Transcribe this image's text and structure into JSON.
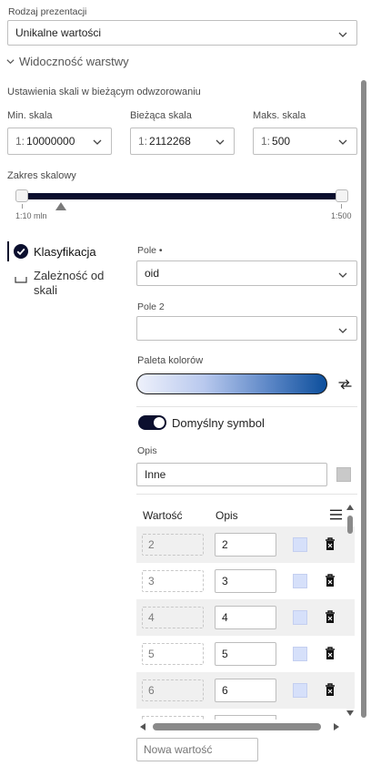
{
  "presentation": {
    "label": "Rodzaj prezentacji",
    "value": "Unikalne wartości"
  },
  "visibility": {
    "section_title": "Widoczność warstwy",
    "scale_settings_label": "Ustawienia skali w bieżącym odwzorowaniu",
    "min_scale": {
      "label": "Min. skala",
      "prefix": "1:",
      "value": "10000000"
    },
    "current_scale": {
      "label": "Bieżąca skala",
      "prefix": "1:",
      "value": "2112268"
    },
    "max_scale": {
      "label": "Maks. skala",
      "prefix": "1:",
      "value": "500"
    },
    "range": {
      "label": "Zakres skalowy",
      "min_label": "1:10 mln",
      "max_label": "1:500"
    }
  },
  "tabs": {
    "classification": "Klasyfikacja",
    "scale_dependency": "Zależność od skali"
  },
  "form": {
    "field_label": "Pole •",
    "field_value": "oid",
    "field2_label": "Pole 2",
    "field2_value": "",
    "palette_label": "Paleta kolorów",
    "default_symbol_label": "Domyślny symbol",
    "default_symbol_on": true,
    "description_label": "Opis",
    "description_value": "Inne",
    "new_value_placeholder": "Nowa wartość"
  },
  "table": {
    "col_value": "Wartość",
    "col_desc": "Opis",
    "rows": [
      {
        "value": "2",
        "desc": "2"
      },
      {
        "value": "3",
        "desc": "3"
      },
      {
        "value": "4",
        "desc": "4"
      },
      {
        "value": "5",
        "desc": "5"
      },
      {
        "value": "6",
        "desc": "6"
      }
    ]
  },
  "colors": {
    "accent_dark": "#0b0f2e",
    "palette_start": "#e8ecfa",
    "palette_end": "#0d4f9c",
    "swatch": "#d6e0fa"
  },
  "icons": [
    "chevron-down-icon",
    "check-circle-icon",
    "swap-icon",
    "menu-icon",
    "trash-icon"
  ]
}
